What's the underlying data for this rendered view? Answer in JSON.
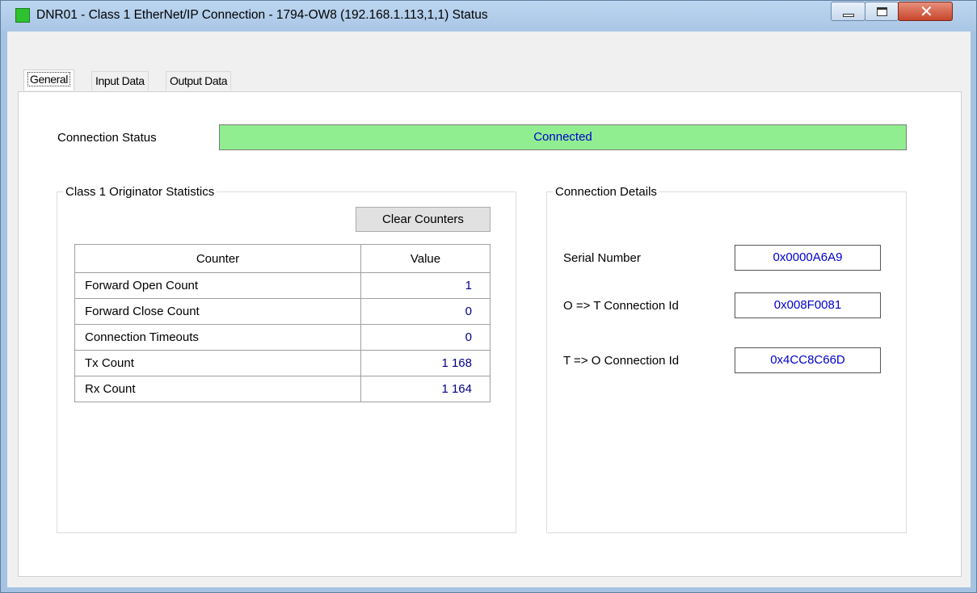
{
  "window": {
    "title": "DNR01 - Class 1 EtherNet/IP Connection - 1794-OW8 (192.168.1.113,1,1) Status",
    "icon_color": "#2fc12f"
  },
  "tabs": [
    {
      "label": "General",
      "active": true
    },
    {
      "label": "Input Data",
      "active": false
    },
    {
      "label": "Output Data",
      "active": false
    }
  ],
  "connection_status": {
    "label": "Connection Status",
    "value": "Connected",
    "color": "#90ee90"
  },
  "originator_stats": {
    "title": "Class 1 Originator Statistics",
    "clear_button": "Clear Counters",
    "headers": [
      "Counter",
      "Value"
    ],
    "rows": [
      {
        "counter": "Forward Open Count",
        "value": "1"
      },
      {
        "counter": "Forward Close Count",
        "value": "0"
      },
      {
        "counter": "Connection Timeouts",
        "value": "0"
      },
      {
        "counter": "Tx Count",
        "value": "1 168"
      },
      {
        "counter": "Rx Count",
        "value": "1 164"
      }
    ]
  },
  "connection_details": {
    "title": "Connection Details",
    "serial_label": "Serial Number",
    "serial_value": "0x0000A6A9",
    "ot_label": "O => T Connection Id",
    "ot_value": "0x008F0081",
    "to_label": "T => O Connection Id",
    "to_value": "0x4CC8C66D"
  }
}
